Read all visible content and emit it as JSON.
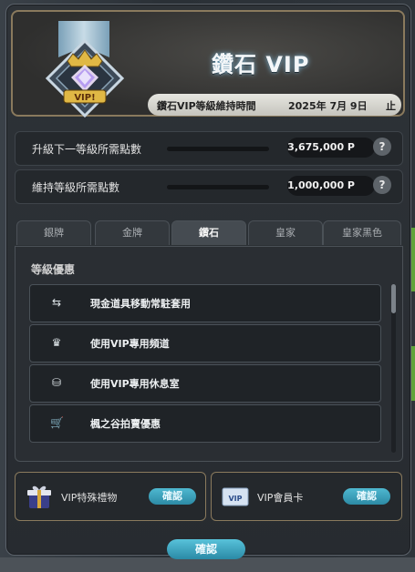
{
  "header": {
    "title": "鑽石 VIP",
    "badge_text": "VIP!",
    "period_label": "鑽石VIP等級維持時間",
    "period_date": "2025年  7月  9日",
    "period_suffix": "止"
  },
  "points": [
    {
      "label": "升級下一等級所需點數",
      "value": "3,675,000 P",
      "help": "?"
    },
    {
      "label": "維持等級所需點數",
      "value": "1,000,000 P",
      "help": "?"
    }
  ],
  "tabs": [
    {
      "label": "銀牌",
      "active": false
    },
    {
      "label": "金牌",
      "active": false
    },
    {
      "label": "鑽石",
      "active": true
    },
    {
      "label": "皇家",
      "active": false
    },
    {
      "label": "皇家黑色",
      "active": false
    }
  ],
  "benefits": {
    "title": "等級優惠",
    "items": [
      {
        "icon": "swap-arrows-icon",
        "glyph": "⇆",
        "label": "現金道具移動常駐套用"
      },
      {
        "icon": "crown-icon",
        "glyph": "♛",
        "label": "使用VIP專用頻道"
      },
      {
        "icon": "lounge-chair-icon",
        "glyph": "⛁",
        "label": "使用VIP專用休息室"
      },
      {
        "icon": "cart-icon",
        "glyph": "🛒",
        "label": "楓之谷拍賣優惠"
      }
    ]
  },
  "rewards": [
    {
      "icon": "gift-box-icon",
      "label": "VIP特殊禮物",
      "button": "確認"
    },
    {
      "icon": "vip-card-icon",
      "label": "VIP會員卡",
      "button": "確認"
    }
  ],
  "confirm_label": "確認",
  "colors": {
    "accent": "#3aa5c0",
    "frame_gold": "#8a7a5d",
    "panel": "#2a2e33"
  }
}
